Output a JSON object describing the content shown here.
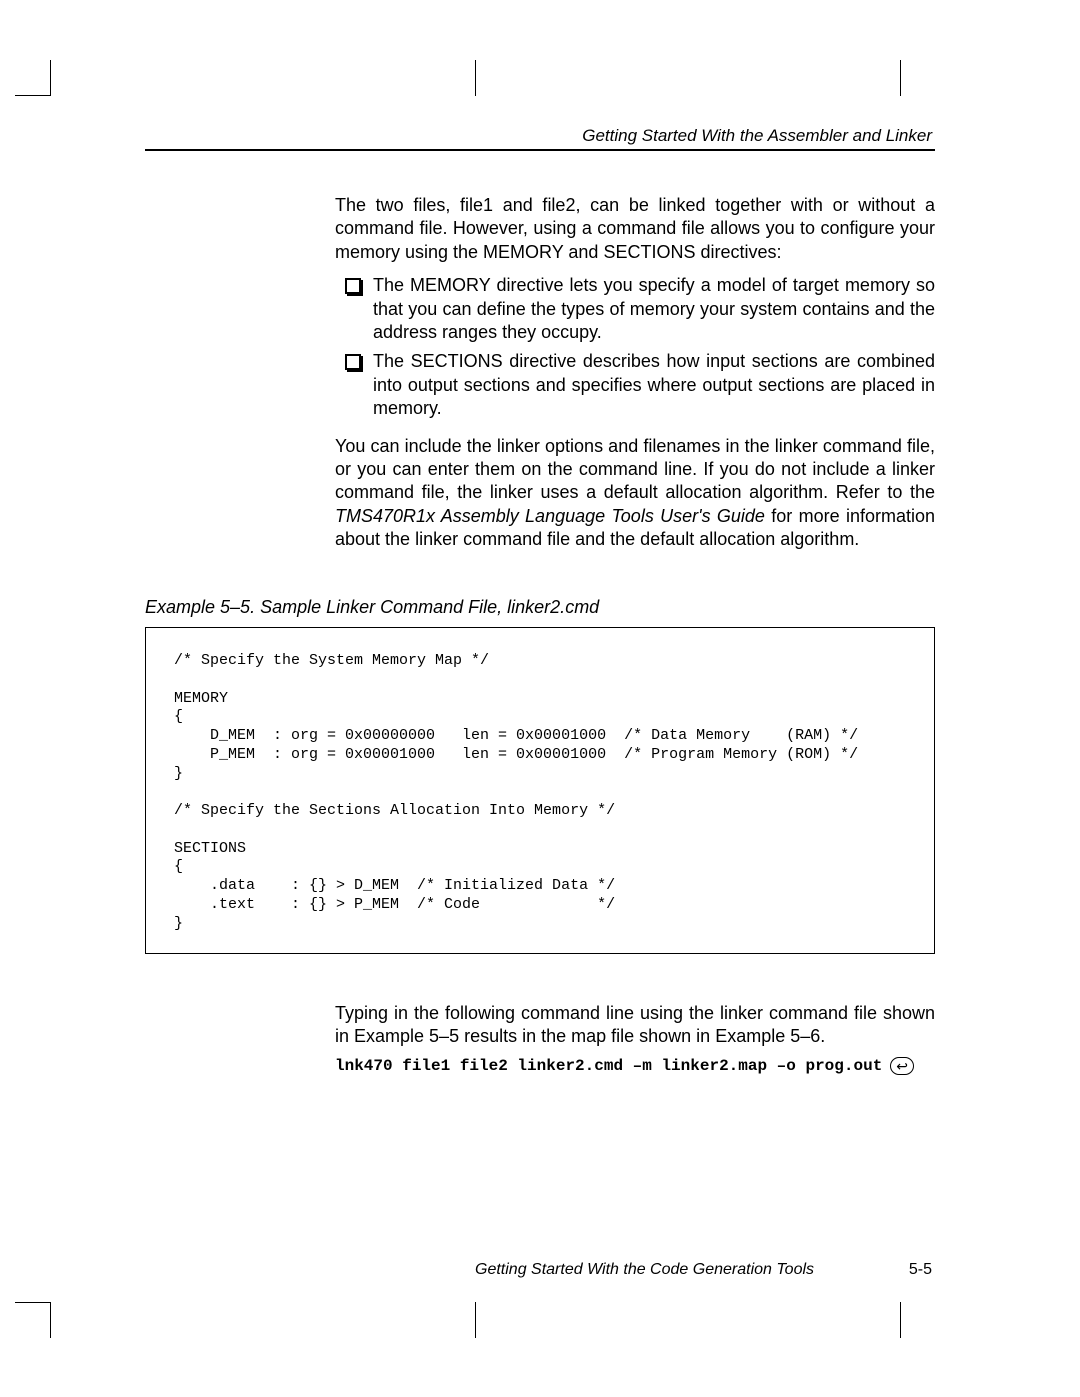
{
  "header": {
    "running_title": "Getting Started With the Assembler and Linker"
  },
  "body": {
    "intro": "The two files, file1 and file2, can be linked together with or without a command file. However, using a command file allows you to configure your memory using the MEMORY and SECTIONS directives:",
    "bullets": [
      "The MEMORY directive lets you specify a model of target memory so that you can define the types of memory your system contains and the address ranges they occupy.",
      "The SECTIONS directive describes how input sections are combined into output sections and specifies where output sections are placed in memory."
    ],
    "after_bullets_pre": "You can include the linker options and filenames in the linker command file, or you can enter them on the command line. If you do not include a linker command file, the linker uses a default allocation algorithm. Refer to the ",
    "after_bullets_em": "TMS470R1x Assembly Language Tools User's Guide",
    "after_bullets_post": " for more information about the linker command file and the default allocation algorithm."
  },
  "example": {
    "caption": "Example 5–5. Sample Linker Command File, linker2.cmd",
    "code": "/* Specify the System Memory Map */\n\nMEMORY\n{\n    D_MEM  : org = 0x00000000   len = 0x00001000  /* Data Memory    (RAM) */\n    P_MEM  : org = 0x00001000   len = 0x00001000  /* Program Memory (ROM) */\n}\n\n/* Specify the Sections Allocation Into Memory */\n\nSECTIONS\n{\n    .data    : {} > D_MEM  /* Initialized Data */\n    .text    : {} > P_MEM  /* Code             */\n}"
  },
  "after_code": {
    "para": "Typing in the following command line using the linker command file shown in Example 5–5 results in the map file shown in Example 5–6.",
    "cmd": "lnk470 file1 file2 linker2.cmd –m linker2.map –o prog.out",
    "enter_glyph": "↩"
  },
  "footer": {
    "title": "Getting Started With the Code Generation Tools",
    "page": "5-5"
  }
}
